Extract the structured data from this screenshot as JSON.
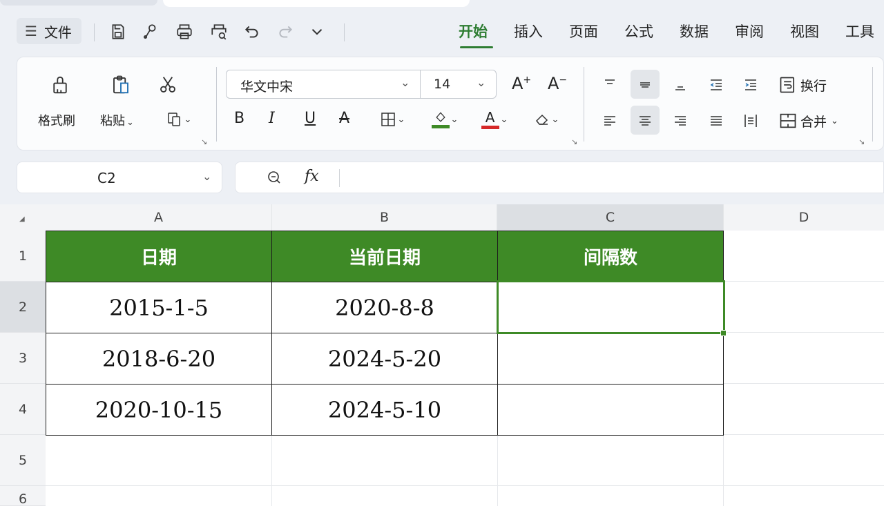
{
  "menubar": {
    "file_label": "文件",
    "quick_access_icons": [
      "save-icon",
      "export-icon",
      "print-icon",
      "print-preview-icon",
      "undo-icon",
      "redo-icon",
      "chevron-down-icon"
    ],
    "tabs": [
      "开始",
      "插入",
      "页面",
      "公式",
      "数据",
      "审阅",
      "视图",
      "工具"
    ],
    "active_tab": "开始"
  },
  "ribbon": {
    "format_painter_label": "格式刷",
    "paste_label": "粘贴",
    "font_name": "华文中宋",
    "font_size": "14",
    "wrap_label": "换行",
    "merge_label": "合并",
    "fill_color": "#3e8a26",
    "font_color": "#d62828"
  },
  "formula_bar": {
    "cell_ref": "C2",
    "fx_label": "fx",
    "formula": ""
  },
  "sheet": {
    "columns": [
      "A",
      "B",
      "C",
      "D"
    ],
    "rows": [
      "1",
      "2",
      "3",
      "4",
      "5",
      "6"
    ],
    "selected_column": "C",
    "selected_row": "2",
    "header_color": "#3e8a26",
    "headers": [
      "日期",
      "当前日期",
      "间隔数"
    ],
    "data": [
      [
        "2015-1-5",
        "2020-8-8",
        ""
      ],
      [
        "2018-6-20",
        "2024-5-20",
        ""
      ],
      [
        "2020-10-15",
        "2024-5-10",
        ""
      ]
    ]
  }
}
